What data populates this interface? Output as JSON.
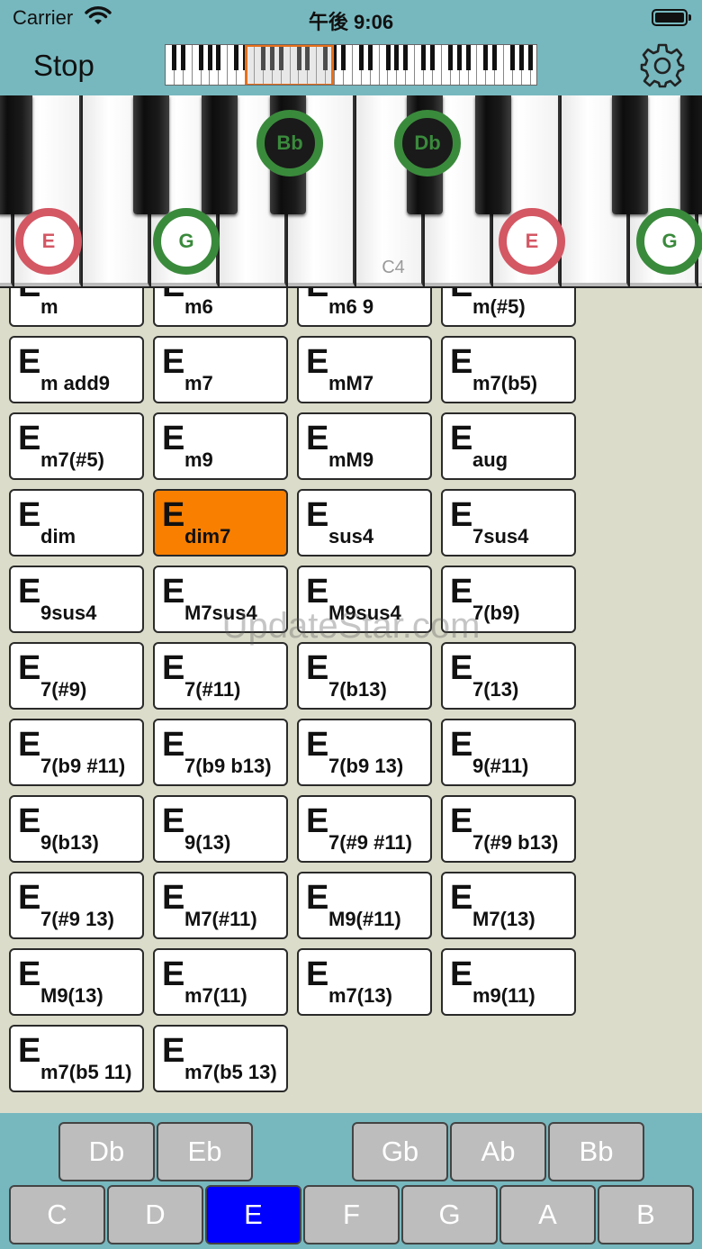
{
  "status_bar": {
    "carrier": "Carrier",
    "time": "午後 9:06"
  },
  "nav": {
    "stop_label": "Stop"
  },
  "keyboard": {
    "c4_label": "C4",
    "notes": [
      "E",
      "G",
      "Bb",
      "Db",
      "E",
      "G"
    ]
  },
  "chord_root": "E",
  "chords": [
    "m",
    "m6",
    "m6 9",
    "m(#5)",
    "m add9",
    "m7",
    "mM7",
    "m7(b5)",
    "m7(#5)",
    "m9",
    "mM9",
    "aug",
    "dim",
    "dim7",
    "sus4",
    "7sus4",
    "9sus4",
    "M7sus4",
    "M9sus4",
    "7(b9)",
    "7(#9)",
    "7(#11)",
    "7(b13)",
    "7(13)",
    "7(b9 #11)",
    "7(b9 b13)",
    "7(b9 13)",
    "9(#11)",
    "9(b13)",
    "9(13)",
    "7(#9 #11)",
    "7(#9 b13)",
    "7(#9 13)",
    "M7(#11)",
    "M9(#11)",
    "M7(13)",
    "M9(13)",
    "m7(11)",
    "m7(13)",
    "m9(11)",
    "m7(b5 11)",
    "m7(b5 13)"
  ],
  "selected_chord": "dim7",
  "watermark": "UpdateStar.com",
  "key_selector": {
    "sharps": [
      "Db",
      "Eb",
      "Gb",
      "Ab",
      "Bb"
    ],
    "naturals": [
      "C",
      "D",
      "E",
      "F",
      "G",
      "A",
      "B"
    ],
    "selected": "E"
  },
  "colors": {
    "bar_teal": "#77b8bf",
    "background": "#dcdccb",
    "selected_chord": "#f97f00",
    "selected_key": "#0000ff",
    "note_red": "#d45764",
    "note_green": "#3a8a3c"
  }
}
